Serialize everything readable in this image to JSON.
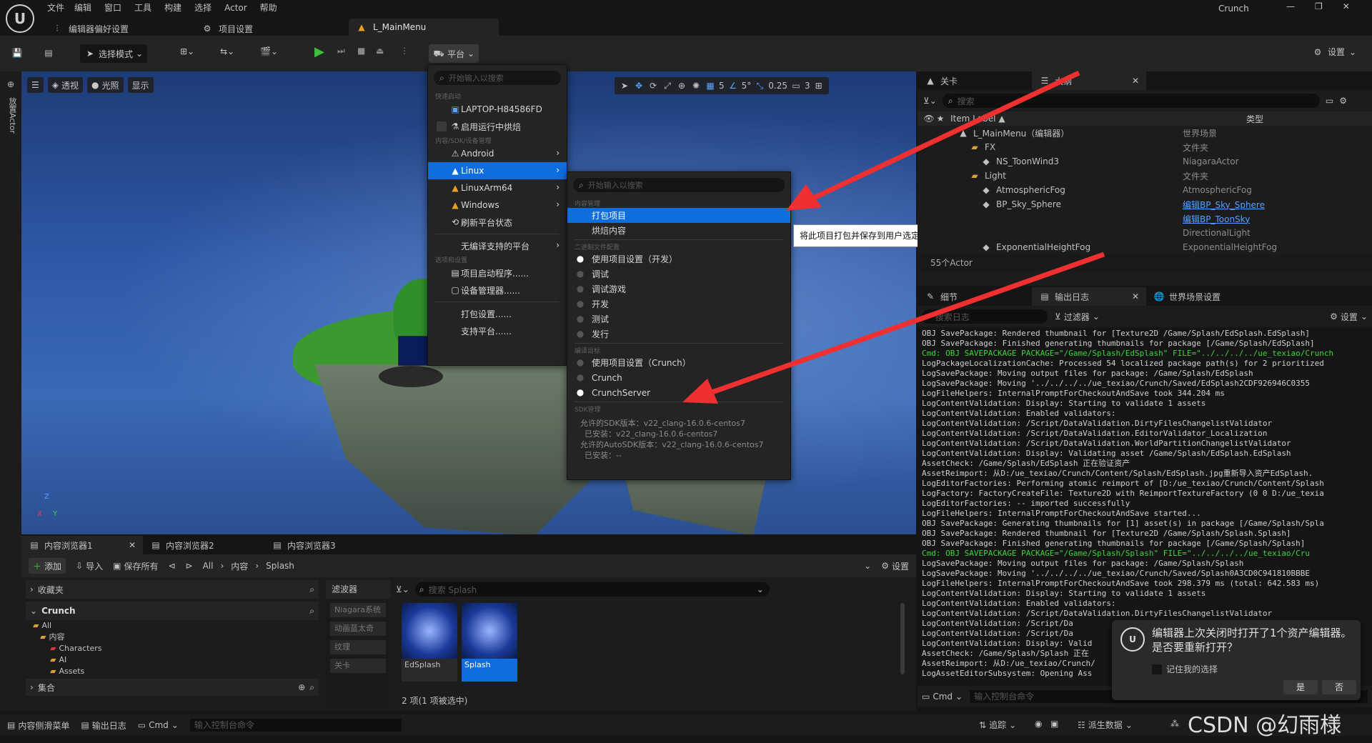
{
  "menubar": {
    "items": [
      "文件",
      "编辑",
      "窗口",
      "工具",
      "构建",
      "选择",
      "Actor",
      "帮助"
    ],
    "app_name": "Crunch"
  },
  "tabs": {
    "editor_prefs": "编辑器偏好设置",
    "project_settings": "项目设置",
    "level": "L_MainMenu"
  },
  "toolbar": {
    "select_mode": "选择模式",
    "platform": "平台",
    "settings": "设置"
  },
  "left_vertical": "放置Actor",
  "viewport": {
    "perspective": "透视",
    "lit": "光照",
    "show": "显示",
    "grid_val": "5",
    "angle_val": "5°",
    "scale_val": "0.25",
    "cam_val": "3"
  },
  "platform_menu": {
    "search_placeholder": "开始输入以搜索",
    "section_quick": "快速启动",
    "device_name": "LAPTOP-H84586FD",
    "enable_cook": "启用运行中烘焙",
    "section_sdk": "内容/SDK/设备管理",
    "platforms": [
      "Android",
      "Linux",
      "LinuxArm64",
      "Windows"
    ],
    "refresh": "刷新平台状态",
    "unsupported": "无编译支持的平台",
    "section_options": "选项和设置",
    "project_launcher": "项目启动程序......",
    "device_manager": "设备管理器......",
    "packaging_settings": "打包设置......",
    "supported_platforms": "支持平台......"
  },
  "linux_submenu": {
    "search_placeholder": "开始输入以搜索",
    "section_content": "内容管理",
    "package_project": "打包项目",
    "cook_content": "烘焙内容",
    "section_binary": "二进制文件配置",
    "binary_options": [
      "使用项目设置（开发）",
      "调试",
      "调试游戏",
      "开发",
      "测试",
      "发行"
    ],
    "section_build_target": "编译目标",
    "target_options": [
      "使用项目设置（Crunch）",
      "Crunch",
      "CrunchServer"
    ],
    "section_sdk": "SDK管理",
    "sdk_lines": [
      "允许的SDK版本：v22_clang-16.0.6-centos7",
      "已安装：v22_clang-16.0.6-centos7",
      "允许的AutoSDK版本：v22_clang-16.0.6-centos7",
      "已安装：--"
    ]
  },
  "tooltip": "将此项目打包并保存到用户选定的目录中。然后可将其用于安装和运行。",
  "outliner": {
    "tab_level": "关卡",
    "tab_outline": "大纲",
    "search_placeholder": "搜索",
    "col_label": "Item Label ▲",
    "col_type": "类型",
    "rows": [
      {
        "indent": 2,
        "label": "L_MainMenu（编辑器）",
        "type": "世界场景",
        "link": false,
        "icon": "level-icon"
      },
      {
        "indent": 3,
        "label": "FX",
        "type": "文件夹",
        "link": false,
        "icon": "folder-icon"
      },
      {
        "indent": 4,
        "label": "NS_ToonWind3",
        "type": "NiagaraActor",
        "link": false,
        "icon": "niagara-icon"
      },
      {
        "indent": 3,
        "label": "Light",
        "type": "文件夹",
        "link": false,
        "icon": "folder-icon"
      },
      {
        "indent": 4,
        "label": "AtmosphericFog",
        "type": "AtmosphericFog",
        "link": false,
        "icon": "fog-icon"
      },
      {
        "indent": 4,
        "label": "BP_Sky_Sphere",
        "type": "编辑BP_Sky_Sphere",
        "link": true,
        "icon": "sphere-icon"
      },
      {
        "indent": 4,
        "label": "",
        "type": "编辑BP_ToonSky",
        "link": true,
        "icon": ""
      },
      {
        "indent": 4,
        "label": "",
        "type": "DirectionalLight",
        "link": false,
        "icon": ""
      },
      {
        "indent": 4,
        "label": "ExponentialHeightFog",
        "type": "ExponentialHeightFog",
        "link": false,
        "icon": "fog-icon"
      }
    ],
    "count": "55个Actor"
  },
  "output": {
    "tab_details": "细节",
    "tab_log": "输出日志",
    "tab_world": "世界场景设置",
    "search_placeholder": "搜索日志",
    "filter": "过滤器",
    "settings": "设置",
    "lines": [
      {
        "t": "OBJ SavePackage:     Rendered thumbnail for [Texture2D /Game/Splash/EdSplash.EdSplash]",
        "g": false
      },
      {
        "t": "OBJ SavePackage: Finished generating thumbnails for package [/Game/Splash/EdSplash]",
        "g": false
      },
      {
        "t": "Cmd: OBJ SAVEPACKAGE PACKAGE=\"/Game/Splash/EdSplash\" FILE=\"../../../../ue_texiao/Crunch",
        "g": true
      },
      {
        "t": "LogPackageLocalizationCache: Processed 54 localized package path(s) for 2 prioritized",
        "g": false
      },
      {
        "t": "LogSavePackage: Moving output files for package: /Game/Splash/EdSplash",
        "g": false
      },
      {
        "t": "LogSavePackage: Moving '../../../../ue_texiao/Crunch/Saved/EdSplash2CDF926946C0355",
        "g": false
      },
      {
        "t": "LogFileHelpers: InternalPromptForCheckoutAndSave took 344.204 ms",
        "g": false
      },
      {
        "t": "LogContentValidation: Display: Starting to validate 1 assets",
        "g": false
      },
      {
        "t": "LogContentValidation: Enabled validators:",
        "g": false
      },
      {
        "t": "LogContentValidation:     /Script/DataValidation.DirtyFilesChangelistValidator",
        "g": false
      },
      {
        "t": "LogContentValidation:     /Script/DataValidation.EditorValidator_Localization",
        "g": false
      },
      {
        "t": "LogContentValidation:     /Script/DataValidation.WorldPartitionChangelistValidator",
        "g": false
      },
      {
        "t": "LogContentValidation: Display: Validating asset /Game/Splash/EdSplash.EdSplash",
        "g": false
      },
      {
        "t": "AssetCheck: /Game/Splash/EdSplash 正在验证资产",
        "g": false
      },
      {
        "t": "AssetReimport: 从D:/ue_texiao/Crunch/Content/Splash/EdSplash.jpg重新导入资产EdSplash.",
        "g": false
      },
      {
        "t": "LogEditorFactories: Performing atomic reimport of [D:/ue_texiao/Crunch/Content/Splash",
        "g": false
      },
      {
        "t": "LogFactory: FactoryCreateFile: Texture2D with ReimportTextureFactory (0 0 D:/ue_texia",
        "g": false
      },
      {
        "t": "LogEditorFactories: -- imported successfully",
        "g": false
      },
      {
        "t": "LogFileHelpers: InternalPromptForCheckoutAndSave started...",
        "g": false
      },
      {
        "t": "OBJ SavePackage: Generating thumbnails for [1] asset(s) in package [/Game/Splash/Spla",
        "g": false
      },
      {
        "t": "OBJ SavePackage:     Rendered thumbnail for [Texture2D /Game/Splash/Splash.Splash]",
        "g": false
      },
      {
        "t": "OBJ SavePackage: Finished generating thumbnails for package [/Game/Splash/Splash]",
        "g": false
      },
      {
        "t": "Cmd: OBJ SAVEPACKAGE PACKAGE=\"/Game/Splash/Splash\" FILE=\"../../../../ue_texiao/Cru",
        "g": true
      },
      {
        "t": "LogSavePackage: Moving output files for package: /Game/Splash/Splash",
        "g": false
      },
      {
        "t": "LogSavePackage: Moving '../../../../ue_texiao/Crunch/Saved/Splash0A3CD0C941810BBBE",
        "g": false
      },
      {
        "t": "LogFileHelpers: InternalPromptForCheckoutAndSave took 298.379 ms (total: 642.583 ms)",
        "g": false
      },
      {
        "t": "LogContentValidation: Display: Starting to validate 1 assets",
        "g": false
      },
      {
        "t": "LogContentValidation: Enabled validators:",
        "g": false
      },
      {
        "t": "LogContentValidation:     /Script/DataValidation.DirtyFilesChangelistValidator",
        "g": false
      },
      {
        "t": "LogContentValidation:     /Script/Da",
        "g": false
      },
      {
        "t": "LogContentValidation:     /Script/Da",
        "g": false
      },
      {
        "t": "LogContentValidation: Display: Valid",
        "g": false
      },
      {
        "t": "AssetCheck: /Game/Splash/Splash 正在",
        "g": false
      },
      {
        "t": "AssetReimport: 从D:/ue_texiao/Crunch/",
        "g": false
      },
      {
        "t": "LogAssetEditorSubsystem: Opening Ass",
        "g": false
      }
    ],
    "cmd": "Cmd",
    "cmd_placeholder": "输入控制台命令"
  },
  "notify": {
    "text": "编辑器上次关闭时打开了1个资产编辑器。是否要重新打开？",
    "remember": "记住我的选择",
    "yes": "是",
    "no": "否"
  },
  "content_browser": {
    "tabs": [
      "内容浏览器1",
      "内容浏览器2",
      "内容浏览器3"
    ],
    "add": "添加",
    "import": "导入",
    "save_all": "保存所有",
    "path": [
      "All",
      "内容",
      "Splash"
    ],
    "settings": "设置",
    "favorites": "收藏夹",
    "project": "Crunch",
    "tree": [
      "All",
      "内容",
      "Characters",
      "AI",
      "Assets"
    ],
    "collections": "集合",
    "filters_title": "滤波器",
    "filters": [
      "Niagara系统",
      "动画蓝太奇",
      "纹理",
      "关卡"
    ],
    "search_placeholder": "搜索 Splash",
    "assets": [
      "EdSplash",
      "Splash"
    ],
    "status": "2 项(1 项被选中)"
  },
  "statusbar": {
    "drawer": "内容侧滑菜单",
    "log": "输出日志",
    "cmd": "Cmd",
    "cmd_placeholder": "输入控制台命令",
    "trace": "追踪",
    "derived": "派生数据",
    "watermark": "CSDN @幻雨様"
  }
}
